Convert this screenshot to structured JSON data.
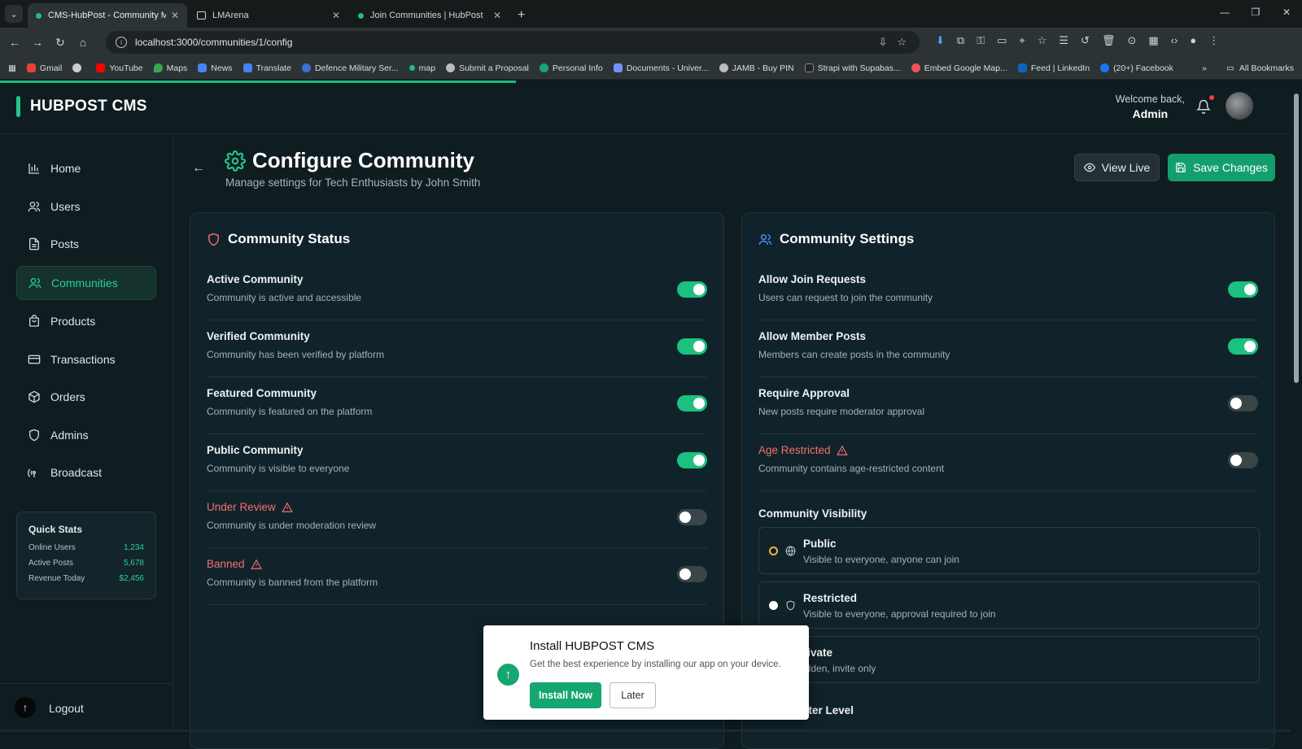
{
  "browser": {
    "tabs": [
      {
        "title": "CMS-HubPost - Community Ma",
        "active": true
      },
      {
        "title": "LMArena",
        "active": false
      },
      {
        "title": "Join Communities | HubPost",
        "active": false
      }
    ],
    "url": "localhost:3000/communities/1/config",
    "bookmarks": [
      "Gmail",
      "YouTube",
      "Maps",
      "News",
      "Translate",
      "Defence Military Ser...",
      "map",
      "Submit a Proposal",
      "Personal Info",
      "Documents - Univer...",
      "JAMB - Buy PIN",
      "Strapi with Supabas...",
      "Embed Google Map...",
      "Feed | LinkedIn",
      "(20+) Facebook"
    ],
    "all_bookmarks": "All Bookmarks",
    "more": "»"
  },
  "app": {
    "logo": "HUBPOST CMS",
    "welcome": "Welcome back,",
    "user": "Admin"
  },
  "sidebar": {
    "items": [
      "Home",
      "Users",
      "Posts",
      "Communities",
      "Products",
      "Transactions",
      "Orders",
      "Admins",
      "Broadcast"
    ],
    "active": "Communities",
    "quick_stats": {
      "title": "Quick Stats",
      "rows": [
        {
          "label": "Online Users",
          "value": "1,234"
        },
        {
          "label": "Active Posts",
          "value": "5,678"
        },
        {
          "label": "Revenue Today",
          "value": "$2,456"
        }
      ]
    },
    "logout": "Logout"
  },
  "page": {
    "title": "Configure Community",
    "subtitle": "Manage settings for Tech Enthusiasts by John Smith",
    "view_live": "View Live",
    "save": "Save Changes"
  },
  "status_card": {
    "title": "Community Status",
    "rows": [
      {
        "label": "Active Community",
        "desc": "Community is active and accessible",
        "on": true,
        "warn": false
      },
      {
        "label": "Verified Community",
        "desc": "Community has been verified by platform",
        "on": true,
        "warn": false
      },
      {
        "label": "Featured Community",
        "desc": "Community is featured on the platform",
        "on": true,
        "warn": false
      },
      {
        "label": "Public Community",
        "desc": "Community is visible to everyone",
        "on": true,
        "warn": false
      },
      {
        "label": "Under Review",
        "desc": "Community is under moderation review",
        "on": false,
        "warn": true
      },
      {
        "label": "Banned",
        "desc": "Community is banned from the platform",
        "on": false,
        "warn": true
      }
    ]
  },
  "settings_card": {
    "title": "Community Settings",
    "rows": [
      {
        "label": "Allow Join Requests",
        "desc": "Users can request to join the community",
        "on": true,
        "warn": false
      },
      {
        "label": "Allow Member Posts",
        "desc": "Members can create posts in the community",
        "on": true,
        "warn": false
      },
      {
        "label": "Require Approval",
        "desc": "New posts require moderator approval",
        "on": false,
        "warn": false
      },
      {
        "label": "Age Restricted",
        "desc": "Community contains age-restricted content",
        "on": false,
        "warn": true
      }
    ],
    "visibility_label": "Community Visibility",
    "visibility_options": [
      {
        "label": "Public",
        "desc": "Visible to everyone, anyone can join",
        "selected": true,
        "icon": "globe-icon"
      },
      {
        "label": "Restricted",
        "desc": "Visible to everyone, approval required to join",
        "selected": false,
        "icon": "shield-icon"
      },
      {
        "label": "rivate",
        "desc": "idden, invite only",
        "selected": false,
        "icon": "lock-icon"
      }
    ],
    "filter_label": "ilter Level"
  },
  "install_popup": {
    "title": "Install HUBPOST CMS",
    "text": "Get the best experience by installing our app on your device.",
    "install": "Install Now",
    "later": "Later"
  },
  "colors": {
    "accent": "#1cc07f",
    "warn": "#f07070",
    "bg": "#0f1c20"
  }
}
